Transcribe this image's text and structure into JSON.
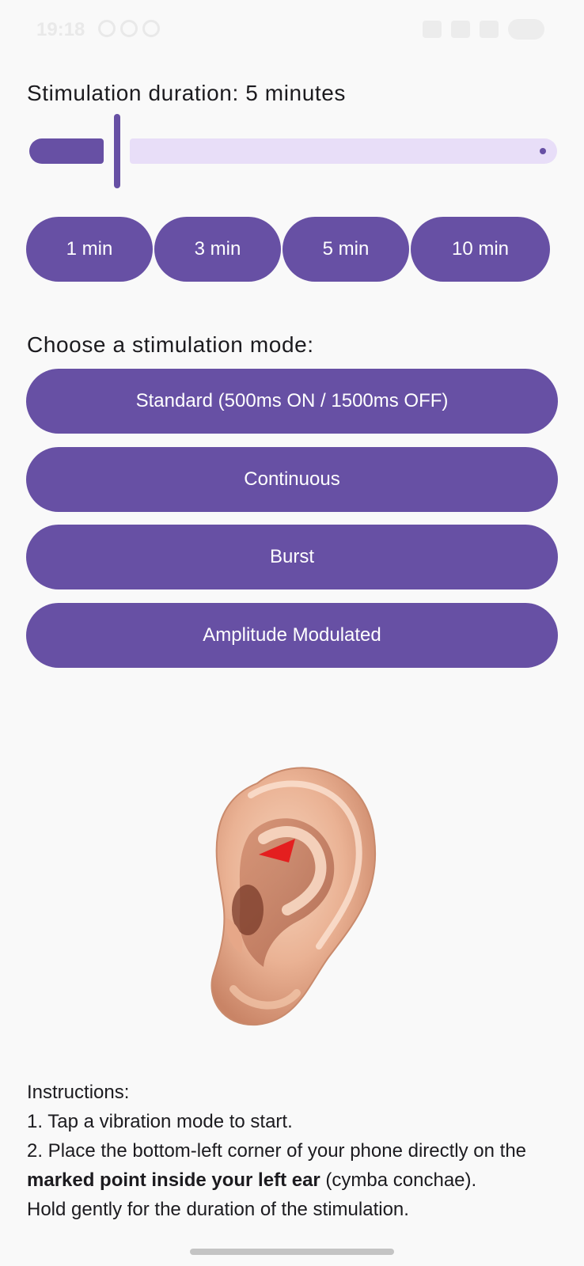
{
  "status_bar": {
    "time": "19:18"
  },
  "duration": {
    "label": "Stimulation duration: 5 minutes",
    "slider_value_minutes": 5
  },
  "presets": [
    {
      "label": "1 min"
    },
    {
      "label": "3 min"
    },
    {
      "label": "5 min"
    },
    {
      "label": "10 min"
    }
  ],
  "modes": {
    "label": "Choose a stimulation mode:",
    "buttons": [
      {
        "label": "Standard (500ms ON / 1500ms OFF)"
      },
      {
        "label": "Continuous"
      },
      {
        "label": "Burst"
      },
      {
        "label": "Amplitude Modulated"
      }
    ]
  },
  "instructions": {
    "heading": "Instructions:",
    "step1": "1. Tap a vibration mode to start.",
    "step2_a": "2. Place the bottom-left corner of your phone directly on the ",
    "step2_bold": "marked point inside your left ear",
    "step2_b": " (cymba conchae).",
    "step3": "Hold gently for the duration of the stimulation."
  },
  "colors": {
    "primary": "#6750a4",
    "track_inactive": "#e8def8",
    "background": "#f9f9f9",
    "marker": "#e41f1f"
  }
}
